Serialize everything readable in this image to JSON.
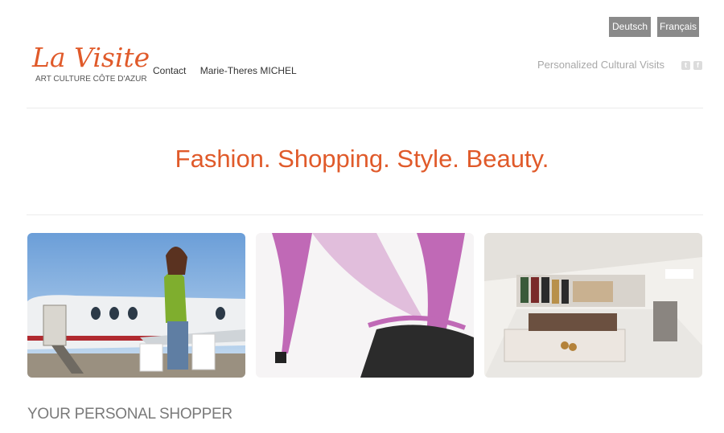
{
  "languages": {
    "de": "Deutsch",
    "fr": "Français"
  },
  "logo": {
    "title": "La Visite",
    "subtitle": "ART CULTURE CÔTE D'AZUR"
  },
  "nav": {
    "items": [
      {
        "label": "Contact"
      },
      {
        "label": "Marie-Theres MICHEL"
      }
    ]
  },
  "header": {
    "tagline": "Personalized Cultural Visits",
    "social": [
      {
        "icon": "twitter-icon",
        "glyph": "t"
      },
      {
        "icon": "facebook-icon",
        "glyph": "f"
      }
    ]
  },
  "hero": {
    "headline": "Fashion. Shopping. Style. Beauty."
  },
  "gallery": [
    {
      "icon": "woman-shopping-jet-photo"
    },
    {
      "icon": "pink-high-heels-photo"
    },
    {
      "icon": "boutique-interior-photo"
    }
  ],
  "section": {
    "title": "YOUR PERSONAL SHOPPER"
  },
  "colors": {
    "accent": "#e05a2a",
    "button": "#8a8a8a",
    "muted": "#a8a8a8"
  }
}
